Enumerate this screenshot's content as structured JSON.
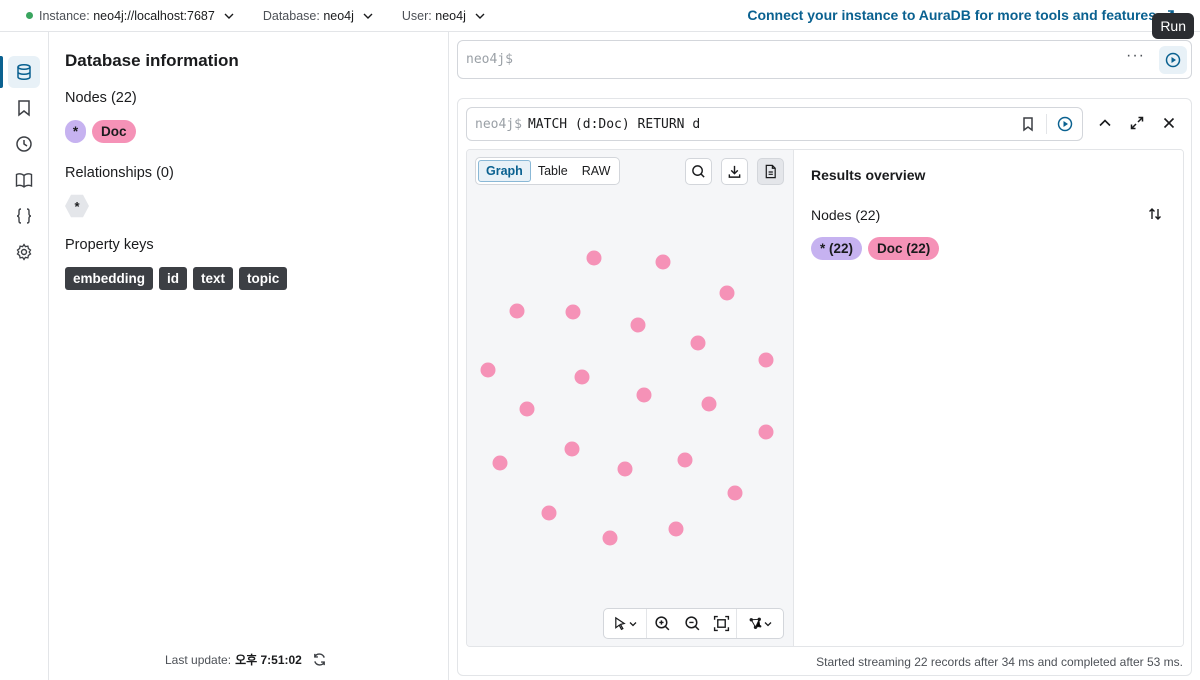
{
  "topbar": {
    "instance_label": "Instance:",
    "instance_value": "neo4j://localhost:7687",
    "database_label": "Database:",
    "database_value": "neo4j",
    "user_label": "User:",
    "user_value": "neo4j",
    "aura_link": "Connect your instance to AuraDB for more tools and features",
    "status_color": "#3aa55f"
  },
  "tooltip": {
    "text": "Run"
  },
  "rail": {
    "items": [
      "database-icon",
      "bookmark-icon",
      "history-icon",
      "book-icon",
      "braces-icon",
      "gear-icon"
    ],
    "active": "database-icon"
  },
  "db_info": {
    "title": "Database information",
    "nodes_heading": "Nodes (22)",
    "node_labels": [
      "*",
      "Doc"
    ],
    "relationships_heading": "Relationships (0)",
    "relationship_types": [
      "*"
    ],
    "property_keys_heading": "Property keys",
    "property_keys": [
      "embedding",
      "id",
      "text",
      "topic"
    ],
    "last_update_label": "Last update:",
    "last_update_value": "오후 7:51:02"
  },
  "editor": {
    "prompt": "neo4j$",
    "more_label": "···"
  },
  "result_frame": {
    "prompt": "neo4j$",
    "query": "MATCH (d:Doc) RETURN d",
    "view_tabs": [
      "Graph",
      "Table",
      "RAW"
    ],
    "active_tab": "Graph",
    "overview_title": "Results overview",
    "overview_nodes": "Nodes (22)",
    "overview_chips": [
      "* (22)",
      "Doc (22)"
    ],
    "status": "Started streaming 22 records after 34 ms and completed after 53 ms.",
    "node_color": "#f592b7",
    "node_count": 22
  }
}
